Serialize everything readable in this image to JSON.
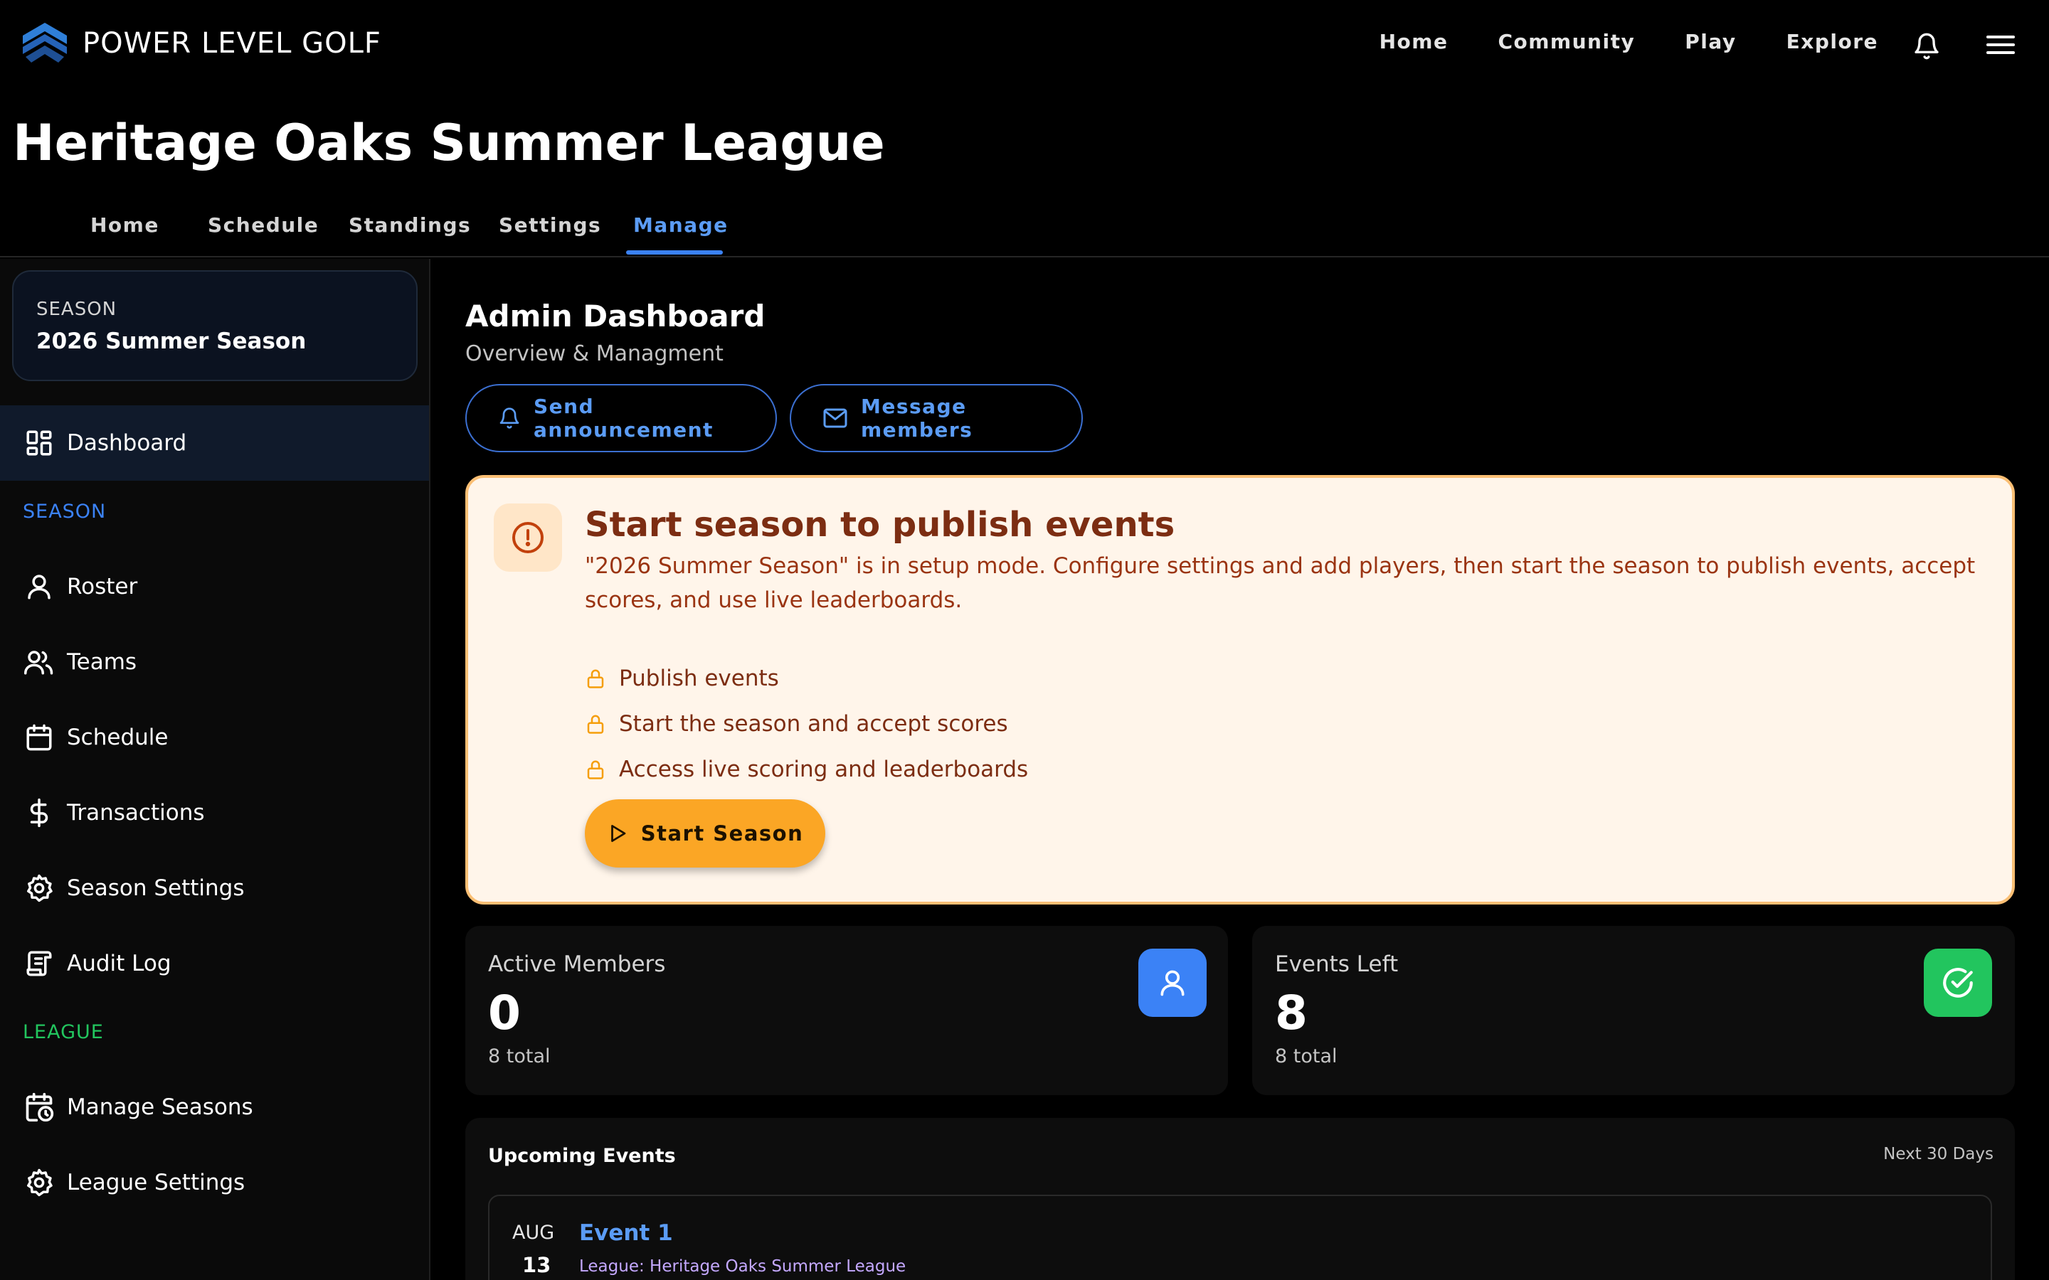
{
  "app": {
    "brand_name": "POWER LEVEL GOLF"
  },
  "topnav": {
    "links": [
      "Home",
      "Community",
      "Play",
      "Explore"
    ]
  },
  "page": {
    "title": "Heritage Oaks Summer League"
  },
  "tabs": [
    {
      "label": "Home"
    },
    {
      "label": "Schedule"
    },
    {
      "label": "Standings"
    },
    {
      "label": "Settings"
    },
    {
      "label": "Manage",
      "active": true
    }
  ],
  "sidebar": {
    "season_card": {
      "label": "SEASON",
      "value": "2026 Summer Season"
    },
    "dashboard": {
      "label": "Dashboard",
      "icon": "dashboard-grid-icon"
    },
    "season_section": {
      "label": "SEASON",
      "color": "#3b82f6"
    },
    "season_items": [
      {
        "label": "Roster",
        "icon": "user-icon"
      },
      {
        "label": "Teams",
        "icon": "users-icon"
      },
      {
        "label": "Schedule",
        "icon": "calendar-icon"
      },
      {
        "label": "Transactions",
        "icon": "dollar-icon"
      },
      {
        "label": "Season Settings",
        "icon": "gear-icon"
      },
      {
        "label": "Audit Log",
        "icon": "scroll-icon"
      }
    ],
    "league_section": {
      "label": "LEAGUE",
      "color": "#22c55e"
    },
    "league_items": [
      {
        "label": "Manage Seasons",
        "icon": "calendar-clock-icon"
      },
      {
        "label": "League Settings",
        "icon": "gear-icon"
      }
    ]
  },
  "main": {
    "title": "Admin Dashboard",
    "subtitle": "Overview & Managment",
    "actions": {
      "announce": {
        "label": "Send announcement",
        "icon": "bell-icon"
      },
      "message": {
        "label": "Message members",
        "icon": "mail-icon"
      }
    },
    "alert": {
      "icon": "alert-circle-icon",
      "title": "Start season to publish events",
      "text": "\"2026 Summer Season\" is in setup mode. Configure settings and add players, then start the season to publish events, accept scores, and use live leaderboards.",
      "locks": [
        "Publish events",
        "Start the season and accept scores",
        "Access live scoring and leaderboards"
      ],
      "button": "Start Season"
    },
    "stats": [
      {
        "label": "Active Members",
        "value": "0",
        "total": "8 total",
        "icon": "user-icon",
        "color": "#3b82f6"
      },
      {
        "label": "Events Left",
        "value": "8",
        "total": "8 total",
        "icon": "check-circle-icon",
        "color": "#22c55e"
      }
    ],
    "upcoming": {
      "title": "Upcoming Events",
      "range": "Next 30 Days",
      "events": [
        {
          "month": "AUG",
          "day": "13",
          "name": "Event 1",
          "league": "League: Heritage Oaks Summer League"
        }
      ]
    }
  }
}
